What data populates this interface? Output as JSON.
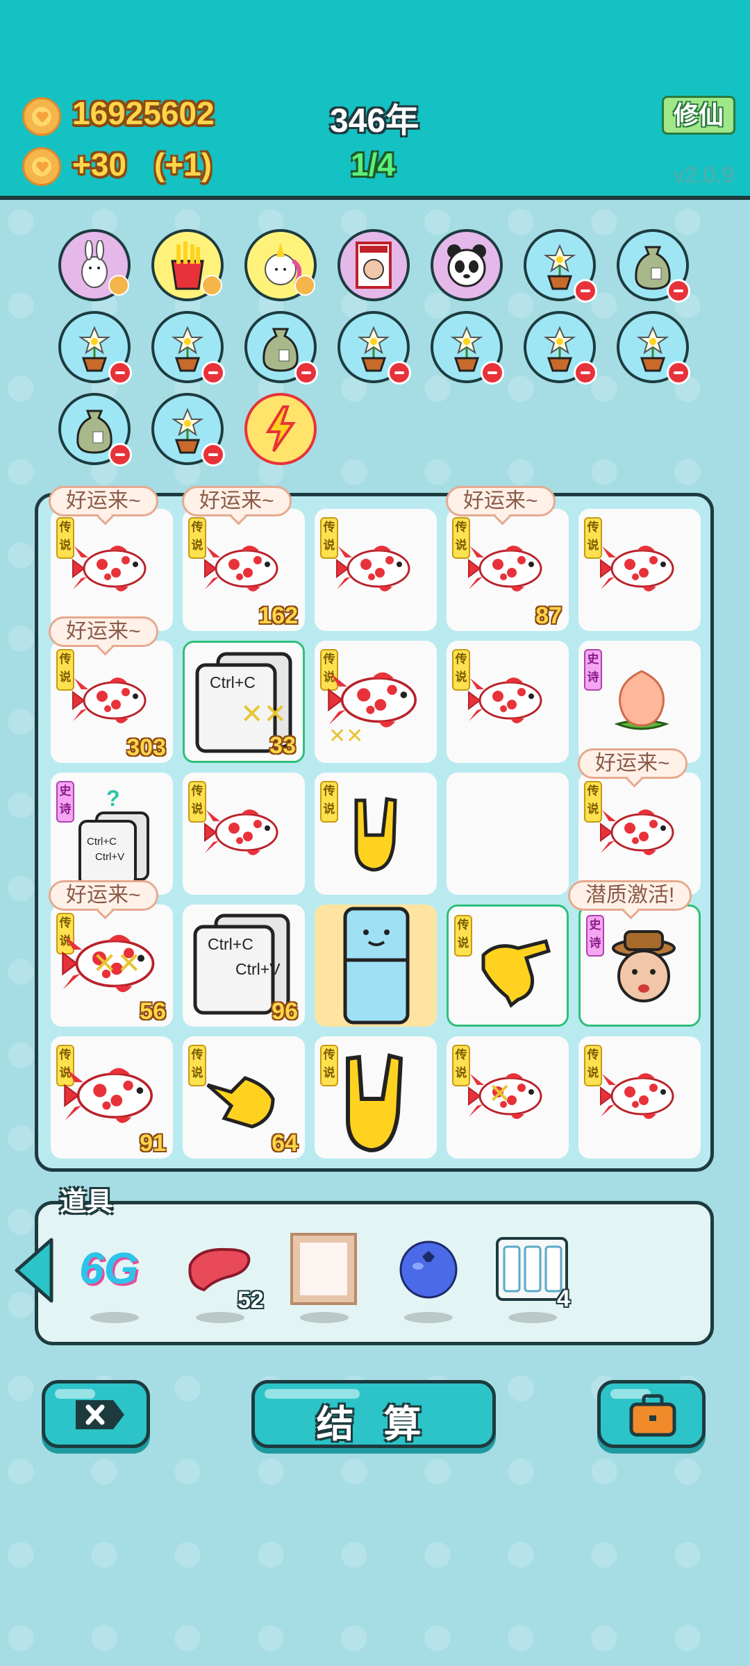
{
  "header": {
    "coins": "16925602",
    "income": "+30",
    "income_bonus": "(+1)",
    "year": "346年",
    "round": "1/4",
    "xiuxian_label": "修仙",
    "version": "v2.0.9"
  },
  "collection": {
    "items": [
      {
        "name": "rabbit-icon",
        "bg": "#e5b8ea"
      },
      {
        "name": "fries-icon",
        "bg": "#fff27a"
      },
      {
        "name": "unicorn-icon",
        "bg": "#fff27a"
      },
      {
        "name": "time-magazine-icon",
        "bg": "#e5b8ea"
      },
      {
        "name": "panda-icon",
        "bg": "#e5b8ea"
      },
      {
        "name": "flower-pot-icon",
        "bg": "#9ee6f4"
      },
      {
        "name": "sack-icon",
        "bg": "#9ee6f4"
      },
      {
        "name": "flower-pot-icon",
        "bg": "#9ee6f4"
      },
      {
        "name": "flower-pot-icon",
        "bg": "#9ee6f4"
      },
      {
        "name": "sack-icon",
        "bg": "#9ee6f4"
      },
      {
        "name": "flower-pot-icon",
        "bg": "#9ee6f4"
      },
      {
        "name": "flower-pot-icon",
        "bg": "#9ee6f4"
      },
      {
        "name": "flower-pot-icon",
        "bg": "#9ee6f4"
      },
      {
        "name": "flower-pot-icon",
        "bg": "#9ee6f4"
      },
      {
        "name": "sack-icon",
        "bg": "#9ee6f4"
      },
      {
        "name": "flower-pot-icon",
        "bg": "#9ee6f4"
      },
      {
        "name": "lightning-icon",
        "bg": "#ffe36b"
      }
    ]
  },
  "board": {
    "legend_tag": "传说",
    "epic_tag": "史诗",
    "luck_bubble": "好运来~",
    "potential_bubble": "潜质激活!",
    "ctrl_c": "Ctrl+C",
    "ctrl_v": "Ctrl+V",
    "counts": {
      "r0c1": "162",
      "r0c3": "87",
      "r1c0": "303",
      "r1c1": "33",
      "r3c0": "56",
      "r3c1": "96",
      "r4c0": "91",
      "r4c1": "64"
    }
  },
  "tools": {
    "title": "道具",
    "six_g": "6G",
    "liver_count": "52",
    "battery_count": "4"
  },
  "buttons": {
    "settle": "结 算"
  },
  "colors": {
    "header": "#15c2c3",
    "accent": "#2cc4c8",
    "coin_text": "#ffd54a",
    "round_text": "#5cf07a"
  }
}
